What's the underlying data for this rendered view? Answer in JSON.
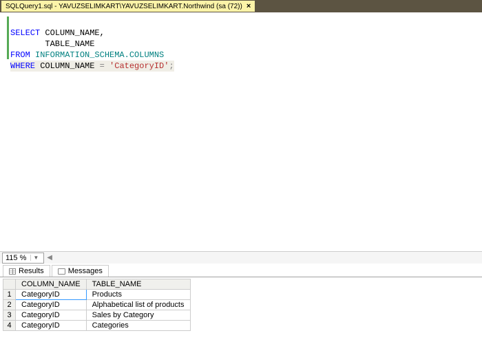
{
  "tab": {
    "title": "SQLQuery1.sql - YAVUZSELIMKART\\YAVUZSELIMKART.Northwind (sa (72))"
  },
  "code": {
    "l1_kw": "SELECT",
    "l1_rest": " COLUMN_NAME,",
    "l2": "       TABLE_NAME",
    "l3_kw": "FROM",
    "l3_schema": " INFORMATION_SCHEMA.COLUMNS",
    "l4_kw": "WHERE",
    "l4_col": " COLUMN_NAME ",
    "l4_eq": "=",
    "l4_str": " 'CategoryID'",
    "l4_end": ";"
  },
  "zoom": {
    "level": "115 %"
  },
  "result_tabs": {
    "results": "Results",
    "messages": "Messages"
  },
  "grid": {
    "columns": [
      "COLUMN_NAME",
      "TABLE_NAME"
    ],
    "rows": [
      {
        "n": "1",
        "c": "CategoryID",
        "t": "Products"
      },
      {
        "n": "2",
        "c": "CategoryID",
        "t": "Alphabetical list of products"
      },
      {
        "n": "3",
        "c": "CategoryID",
        "t": "Sales by Category"
      },
      {
        "n": "4",
        "c": "CategoryID",
        "t": "Categories"
      }
    ]
  }
}
